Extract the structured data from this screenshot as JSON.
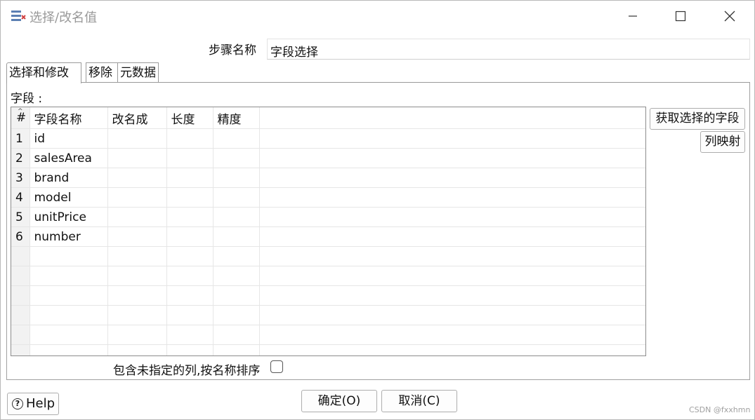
{
  "window": {
    "title": "选择/改名值",
    "icon": "select-rename-icon",
    "controls": [
      "minimize-icon",
      "maximize-icon",
      "close-icon"
    ]
  },
  "step": {
    "label": "步骤名称",
    "value": "字段选择"
  },
  "tabs": [
    {
      "label": "选择和修改",
      "active": true
    },
    {
      "label": "移除",
      "active": false
    },
    {
      "label": "元数据",
      "active": false
    }
  ],
  "fields_label": "字段 :",
  "table": {
    "headers": [
      "#",
      "字段名称",
      "改名成",
      "长度",
      "精度"
    ],
    "rows": [
      [
        "1",
        "id",
        "",
        "",
        ""
      ],
      [
        "2",
        "salesArea",
        "",
        "",
        ""
      ],
      [
        "3",
        "brand",
        "",
        "",
        ""
      ],
      [
        "4",
        "model",
        "",
        "",
        ""
      ],
      [
        "5",
        "unitPrice",
        "",
        "",
        ""
      ],
      [
        "6",
        "number",
        "",
        "",
        ""
      ]
    ]
  },
  "side_buttons": {
    "get_fields": "获取选择的字段",
    "column_mapping": "列映射"
  },
  "checkbox": {
    "label": "包含未指定的列,按名称排序",
    "checked": false
  },
  "buttons": {
    "ok": "确定(O)",
    "cancel": "取消(C)",
    "help": "Help"
  },
  "watermark": "CSDN @fxxhmn"
}
